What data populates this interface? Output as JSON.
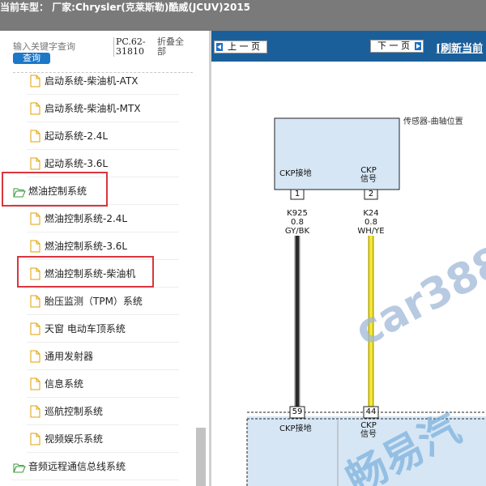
{
  "header": {
    "vehicle_title": "当前车型： 厂家:Chrysler(克莱斯勒)酷威(JCUV)2015"
  },
  "sidebar": {
    "search_placeholder": "输入关键字查询",
    "search_button": "查询",
    "page_code": "PC.62-31810",
    "collapse_all": "折叠全部",
    "items": [
      {
        "label": "启动系统-柴油机-ATX",
        "type": "file"
      },
      {
        "label": "启动系统-柴油机-MTX",
        "type": "file"
      },
      {
        "label": "起动系统-2.4L",
        "type": "file"
      },
      {
        "label": "起动系统-3.6L",
        "type": "file"
      },
      {
        "label": "燃油控制系统",
        "type": "folder"
      },
      {
        "label": "燃油控制系统-2.4L",
        "type": "file"
      },
      {
        "label": "燃油控制系统-3.6L",
        "type": "file"
      },
      {
        "label": "燃油控制系统-柴油机",
        "type": "file"
      },
      {
        "label": "胎压监测（TPM）系统",
        "type": "file"
      },
      {
        "label": "天窗 电动车顶系统",
        "type": "file"
      },
      {
        "label": "通用发射器",
        "type": "file"
      },
      {
        "label": "信息系统",
        "type": "file"
      },
      {
        "label": "巡航控制系统",
        "type": "file"
      },
      {
        "label": "视频娱乐系统",
        "type": "file"
      },
      {
        "label": "音频远程通信总线系统",
        "type": "folder"
      }
    ]
  },
  "nav": {
    "prev_label": "上 一 页",
    "next_label": "下 一 页",
    "refresh_label": "[刷新当前"
  },
  "diagram": {
    "sensor_name": "传感器-曲轴位置",
    "pin_left_label": "CKP接地",
    "pin_right_label": "CKP信号",
    "pin_left_num": "1",
    "pin_right_num": "2",
    "wire_left_id": "K925",
    "wire_left_gauge": "0.8",
    "wire_left_color": "GY/BK",
    "wire_right_id": "K24",
    "wire_right_gauge": "0.8",
    "wire_right_color": "WH/YE",
    "ecm_pin_left_num": "59",
    "ecm_pin_right_num": "44",
    "ecm_left_label": "CKP接地",
    "ecm_right_label": "CKP信号",
    "watermark_1": "car388",
    "watermark_2": "畅易汽"
  },
  "colors": {
    "nav_bar": "#1b5f9a",
    "header_bar": "#7a7a7a",
    "highlight": "#d9363e",
    "component_fill": "#d6e6f5",
    "wire_signal": "#f3e63a",
    "wire_ground": "#2a2a2a"
  }
}
